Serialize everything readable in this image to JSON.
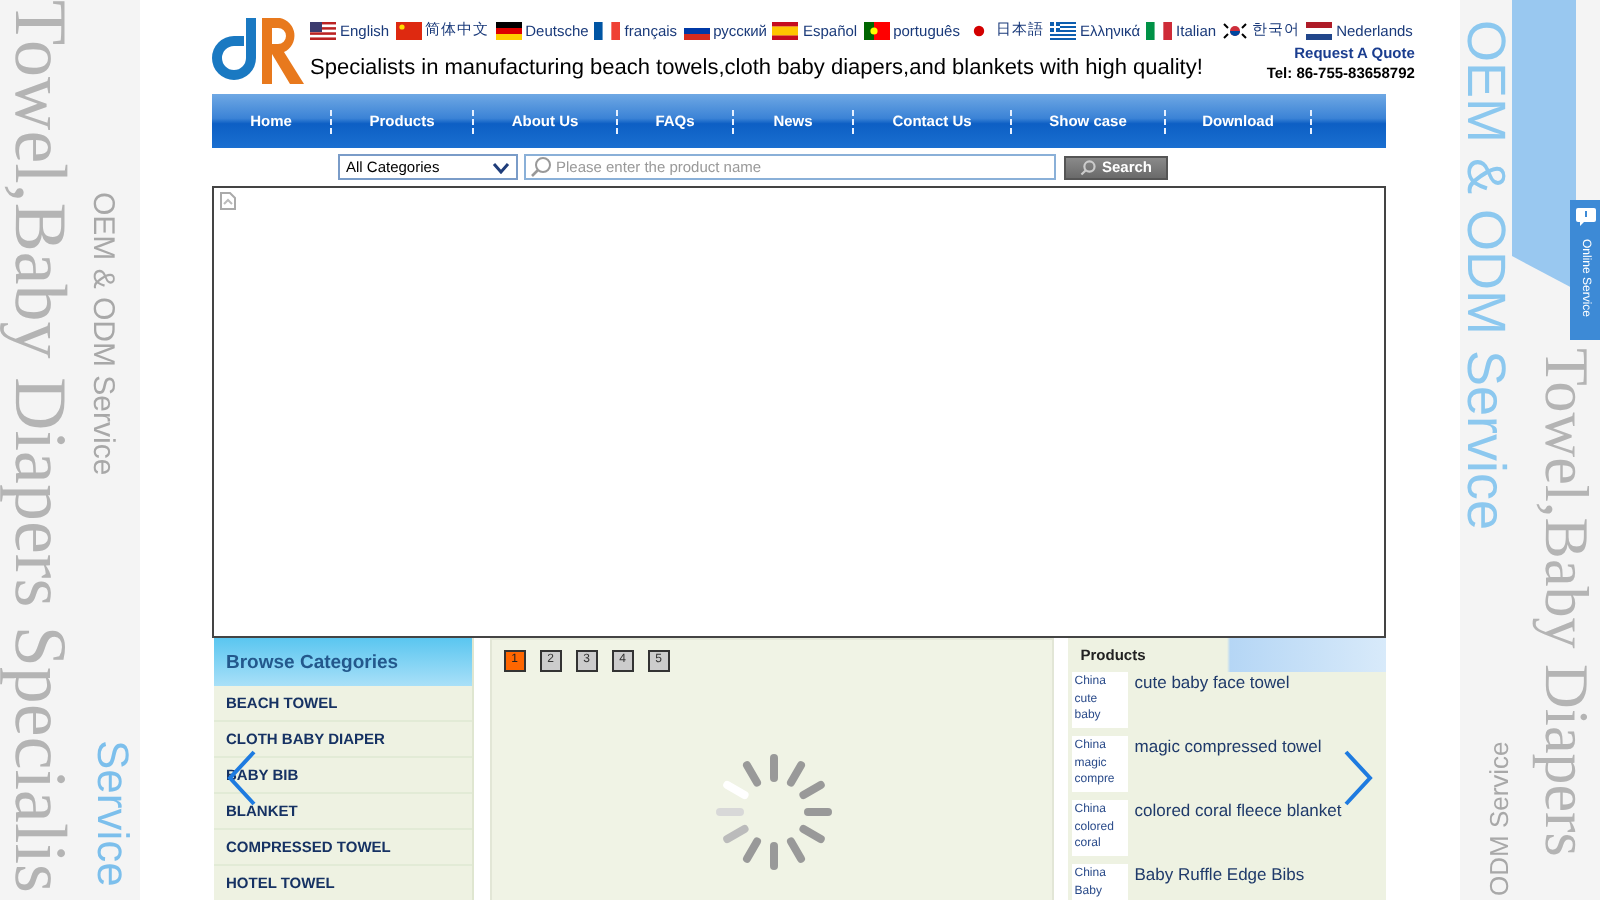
{
  "side_left": {
    "headline": "Towel,Baby Diapers Specialis",
    "subline": "OEM & ODM Service",
    "accent": "Service"
  },
  "side_right": {
    "accent": "OEM & ODM Service",
    "headline": "Towel,Baby Diapers",
    "subline": "ODM Service",
    "online_service": "Online Service"
  },
  "languages": [
    {
      "kind": "us",
      "label": "English"
    },
    {
      "kind": "cn",
      "label": "简体中文"
    },
    {
      "kind": "de",
      "label": "Deutsche"
    },
    {
      "kind": "fr",
      "label": "français"
    },
    {
      "kind": "ru",
      "label": "русский"
    },
    {
      "kind": "es",
      "label": "Español"
    },
    {
      "kind": "pt",
      "label": "português"
    },
    {
      "kind": "jp",
      "label": "日本語"
    },
    {
      "kind": "gr",
      "label": "Ελληνικά"
    },
    {
      "kind": "it",
      "label": "Italian"
    },
    {
      "kind": "kr",
      "label": "한국어"
    },
    {
      "kind": "nl",
      "label": "Nederlands"
    }
  ],
  "tagline": "Specialists in manufacturing beach towels,cloth baby diapers,and blankets with high quality!",
  "quote_link": "Request A Quote",
  "phone": "Tel: 86-755-83658792",
  "nav": [
    "Home",
    "Products",
    "About Us",
    "FAQs",
    "News",
    "Contact Us",
    "Show case",
    "Download"
  ],
  "search": {
    "category": "All Categories",
    "placeholder": "Please enter the product name",
    "button": "Search"
  },
  "categories": {
    "title": "Browse Categories",
    "items": [
      "BEACH TOWEL",
      "CLOTH BABY DIAPER",
      "BABY BIB",
      "BLANKET",
      "COMPRESSED TOWEL",
      "HOTEL TOWEL"
    ]
  },
  "slides": [
    {
      "label": "1",
      "selected": true
    },
    {
      "label": "2",
      "selected": false
    },
    {
      "label": "3",
      "selected": false
    },
    {
      "label": "4",
      "selected": false
    },
    {
      "label": "5",
      "selected": false
    }
  ],
  "products": {
    "title": "Products",
    "items": [
      {
        "thumb": "China cute baby",
        "name": "cute baby face towel"
      },
      {
        "thumb": "China magic compre",
        "name": "magic compressed towel"
      },
      {
        "thumb": "China colored coral",
        "name": "colored coral fleece blanket"
      },
      {
        "thumb": "China Baby",
        "name": "Baby Ruffle Edge Bibs"
      }
    ]
  }
}
